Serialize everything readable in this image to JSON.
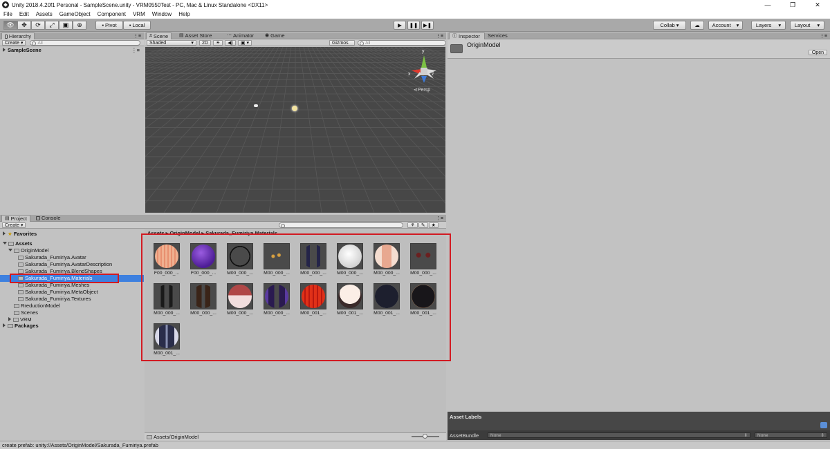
{
  "window": {
    "title": "Unity 2018.4.20f1 Personal - SampleScene.unity - VRM0550Test - PC, Mac & Linux Standalone <DX11>",
    "controls": [
      "—",
      "❐",
      "✕"
    ]
  },
  "menu": [
    "File",
    "Edit",
    "Assets",
    "GameObject",
    "Component",
    "VRM",
    "Window",
    "Help"
  ],
  "toolbar": {
    "pivot": "Pivot",
    "local": "Local",
    "collab": "Collab ▾",
    "account": "Account",
    "layers": "Layers",
    "layout": "Layout"
  },
  "hierarchy": {
    "tab": "Hierarchy",
    "create": "Create",
    "search_placeholder": "All",
    "scene": "SampleScene"
  },
  "scene_tabs": [
    "Scene",
    "Asset Store",
    "Animator",
    "Game"
  ],
  "scene_toolbar": {
    "shading": "Shaded",
    "mode2d": "2D",
    "gizmos": "Gizmos",
    "search_placeholder": "All"
  },
  "scene_gizmo": {
    "y": "y",
    "x": "x",
    "z": "z",
    "persp": "Persp"
  },
  "project": {
    "tabs": [
      "Project",
      "Console"
    ],
    "create": "Create",
    "breadcrumb": "Assets ▸ OriginModel ▸ Sakurada_Fumiriya.Materials",
    "favorites": "Favorites",
    "tree": [
      {
        "label": "Assets",
        "bold": true
      },
      {
        "label": "OriginModel"
      },
      {
        "label": "Sakurada_Fumiriya.Avatar"
      },
      {
        "label": "Sakurada_Fumiriya.AvatarDescription"
      },
      {
        "label": "Sakurada_Fumiriya.BlendShapes"
      },
      {
        "label": "Sakurada_Fumiriya.Materials",
        "selected": true
      },
      {
        "label": "Sakurada_Fumiriya.Meshes"
      },
      {
        "label": "Sakurada_Fumiriya.MetaObject"
      },
      {
        "label": "Sakurada_Fumiriya.Textures"
      },
      {
        "label": "RreductionModel"
      },
      {
        "label": "Scenes"
      },
      {
        "label": "VRM"
      },
      {
        "label": "Packages",
        "bold": true
      }
    ],
    "assets": [
      {
        "label": "F00_000_...",
        "style": "peach-stripes"
      },
      {
        "label": "F00_000_...",
        "style": "purple"
      },
      {
        "label": "M00_000_...",
        "style": "dark-curves"
      },
      {
        "label": "M00_000_...",
        "style": "dark-dots"
      },
      {
        "label": "M00_000_...",
        "style": "navy-shape"
      },
      {
        "label": "M00_000_...",
        "style": "white"
      },
      {
        "label": "M00_000_...",
        "style": "skin"
      },
      {
        "label": "M00_000_...",
        "style": "dark-red"
      },
      {
        "label": "M00_000_...",
        "style": "dark-tie"
      },
      {
        "label": "M00_000_...",
        "style": "brown-hair"
      },
      {
        "label": "M00_000_...",
        "style": "pink-white"
      },
      {
        "label": "M00_000_...",
        "style": "purple-bands"
      },
      {
        "label": "M00_001_...",
        "style": "red-stripes"
      },
      {
        "label": "M00_001_...",
        "style": "face"
      },
      {
        "label": "M00_001_...",
        "style": "black-rim"
      },
      {
        "label": "M00_001_...",
        "style": "black-brown"
      },
      {
        "label": "M00_001_...",
        "style": "blue-white"
      }
    ],
    "footer_path": "Assets/OriginModel"
  },
  "inspector": {
    "tabs": [
      "Inspector",
      "Services"
    ],
    "object_name": "OriginModel",
    "open_button": "Open",
    "asset_labels": "Asset Labels",
    "asset_bundle": "AssetBundle",
    "bundle_value": "None",
    "variant_value": "None"
  },
  "status": "create prefab: unity://Assets/OriginModel/Sakurada_Fumiriya.prefab",
  "colors": {
    "highlight": "#d21a22",
    "selection": "#3d80df"
  }
}
